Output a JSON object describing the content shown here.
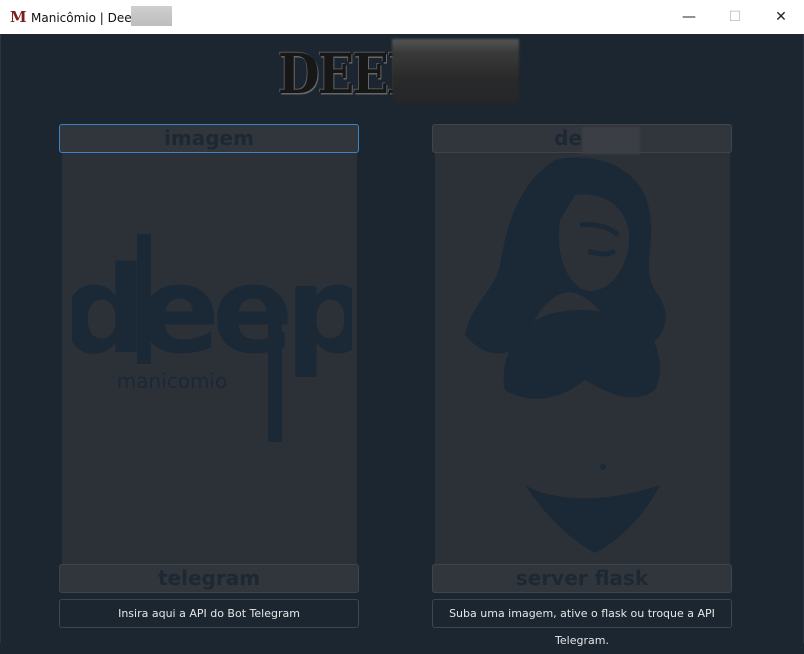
{
  "window": {
    "logo": "M",
    "title": "Manicômio | Deep",
    "minimize": "—",
    "maximize": "☐",
    "close": "✕"
  },
  "banner": {
    "logo_text": "DEEP"
  },
  "left_panel": {
    "header": "imagem",
    "art_word": "deep",
    "art_subword": "manicomio",
    "button": "telegram",
    "field": "Insira aqui a API do Bot Telegram"
  },
  "right_panel": {
    "header": "deep",
    "button": "server flask",
    "field": "Suba uma imagem, ative o flask ou troque a API Telegram."
  }
}
